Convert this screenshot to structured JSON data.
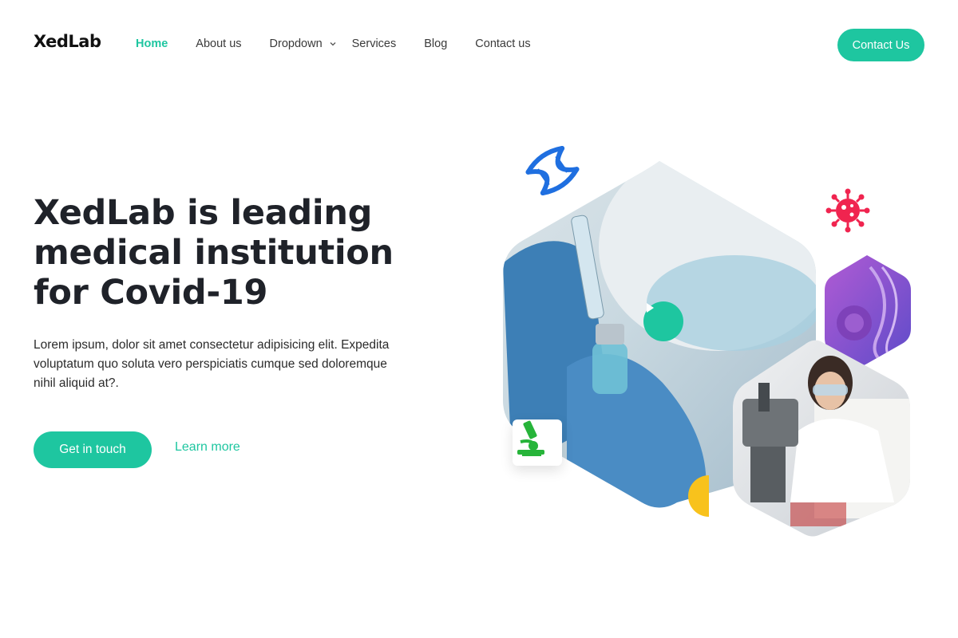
{
  "brand": {
    "logo_text": "XedLab",
    "accent": "#1ec6a0"
  },
  "nav": {
    "items": [
      {
        "label": "Home",
        "active": true
      },
      {
        "label": "About us",
        "active": false
      },
      {
        "label": "Dropdown",
        "active": false,
        "has_dropdown": true
      },
      {
        "label": "Services",
        "active": false
      },
      {
        "label": "Blog",
        "active": false
      },
      {
        "label": "Contact us",
        "active": false
      }
    ],
    "cta_label": "Contact Us"
  },
  "hero": {
    "title": "XedLab is leading medical institution for Covid-19",
    "description": "Lorem ipsum, dolor sit amet consectetur adipisicing elit. Expedita voluptatum quo soluta vero perspiciatis cumque sed doloremque nihil aliquid at?.",
    "primary_button": "Get in touch",
    "secondary_link": "Learn more"
  },
  "art": {
    "icons": [
      "dna-icon",
      "virus-icon",
      "microscope-icon",
      "play-icon"
    ],
    "colors": {
      "dna": "#1f6fe0",
      "virus": "#f0244f",
      "microscope": "#27b43a",
      "half_circle": "#f8c21c"
    }
  }
}
